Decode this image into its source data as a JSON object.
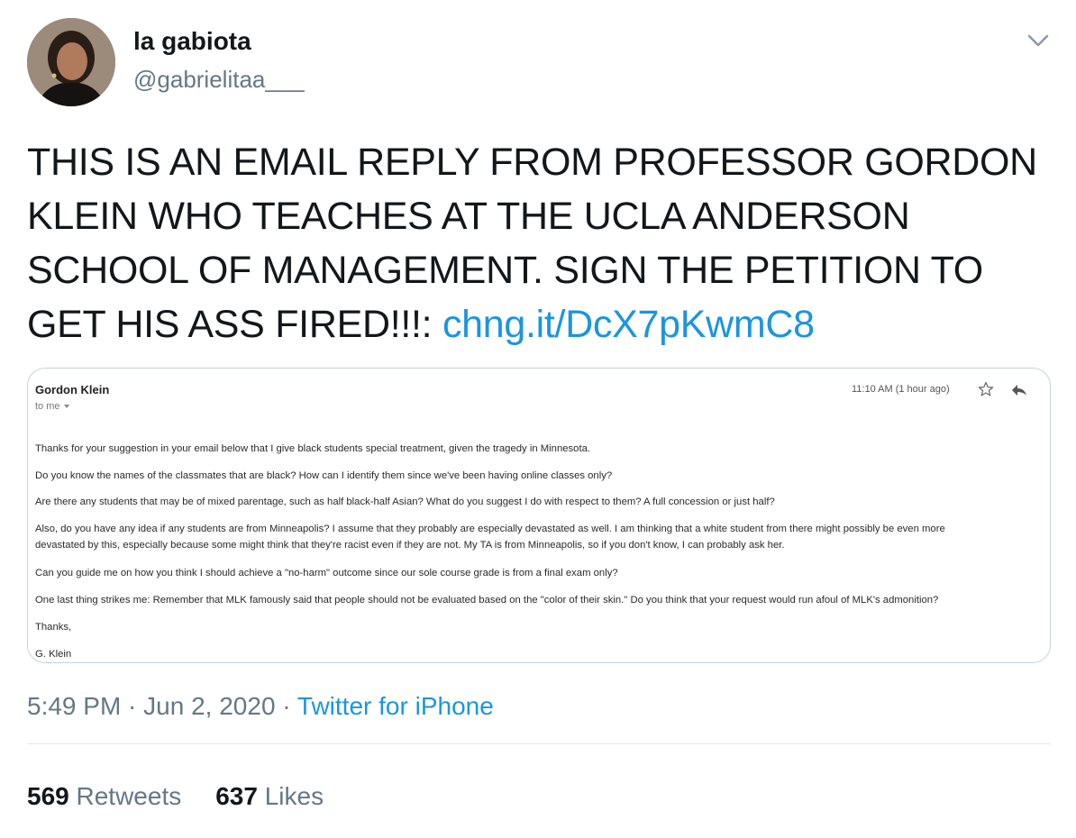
{
  "author": {
    "display_name": "la gabiota",
    "handle": "@gabrielitaa___"
  },
  "tweet": {
    "text": "THIS IS AN EMAIL REPLY FROM PROFESSOR GORDON KLEIN WHO TEACHES AT THE UCLA ANDERSON SCHOOL OF MANAGEMENT. SIGN THE PETITION TO GET HIS ASS FIRED!!!: ",
    "link": "chng.it/DcX7pKwmC8"
  },
  "email": {
    "sender": "Gordon Klein",
    "to": "to me",
    "time": "11:10 AM (1 hour ago)",
    "paragraphs": [
      "Thanks for your suggestion in your email below that I give black students special treatment, given the tragedy in Minnesota.",
      "Do you know the names of the classmates that are black? How can I identify them since we've been having online classes only?",
      "Are there any students that may be of mixed parentage, such as half black-half Asian? What do you suggest I do with respect to them? A full concession or just half?",
      "Also, do you have any idea if any students are from Minneapolis? I assume that they probably are especially devastated as well. I am thinking that a white student from there might possibly be even more",
      "devastated by this, especially because some might think that they're racist even if they are not. My TA is from Minneapolis, so if you don't know, I can probably ask her.",
      "Can you guide me on how you think I should achieve a \"no-harm\" outcome since our sole course grade is from a final exam only?",
      "One last thing strikes me: Remember that MLK famously said that people should not be evaluated based on the \"color of their skin.\" Do you think that your request would run afoul of MLK's admonition?",
      "Thanks,",
      "G. Klein"
    ]
  },
  "meta": {
    "time": "5:49 PM",
    "separator": " · ",
    "date": "Jun 2, 2020",
    "source": "Twitter for iPhone"
  },
  "stats": {
    "retweets_count": "569",
    "retweets_label": "Retweets",
    "likes_count": "637",
    "likes_label": "Likes"
  },
  "icons": {
    "caret": "chevron-down-icon",
    "star": "star-icon",
    "reply": "reply-icon"
  },
  "colors": {
    "link": "#1b95e0",
    "secondary_text": "#657786",
    "primary_text": "#14171a"
  }
}
